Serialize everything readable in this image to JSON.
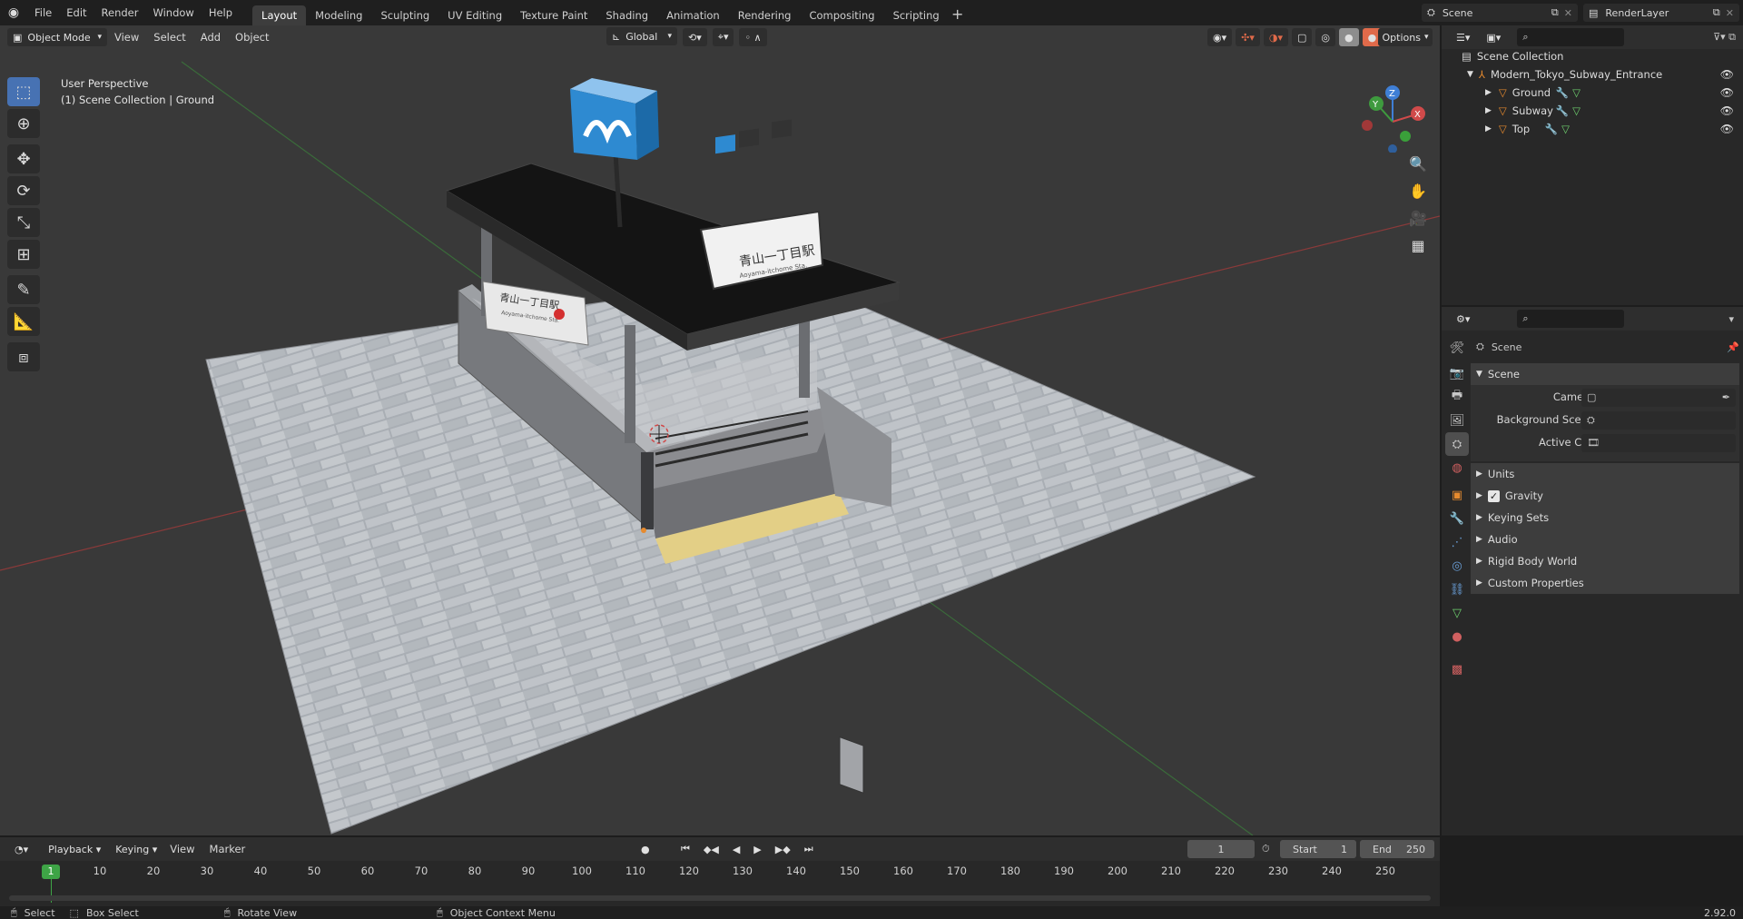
{
  "topbar": {
    "menus": [
      "File",
      "Edit",
      "Render",
      "Window",
      "Help"
    ],
    "workspaces": [
      "Layout",
      "Modeling",
      "Sculpting",
      "UV Editing",
      "Texture Paint",
      "Shading",
      "Animation",
      "Rendering",
      "Compositing",
      "Scripting"
    ],
    "active_workspace": "Layout",
    "add_tab": "+",
    "scene_label": "Scene",
    "renderlayer_label": "RenderLayer"
  },
  "viewport": {
    "mode": "Object Mode",
    "menus": [
      "View",
      "Select",
      "Add",
      "Object"
    ],
    "transform_orientation": "Global",
    "options_label": "Options",
    "overlay_line1": "User Perspective",
    "overlay_line2": "(1) Scene Collection | Ground",
    "gizmo_axes": {
      "x": "X",
      "y": "Y",
      "z": "Z"
    },
    "sign": {
      "main_text": "青山一丁目駅",
      "sub_text": "Aoyama-itchome Sta."
    },
    "side_sign": {
      "main_text": "青山一丁目駅",
      "sub_text": "Aoyama-itchome Sta."
    }
  },
  "outliner": {
    "root": "Scene Collection",
    "collection": "Modern_Tokyo_Subway_Entrance",
    "objects": [
      "Ground",
      "Subway",
      "Top"
    ]
  },
  "properties": {
    "header": "Scene",
    "panel": "Scene",
    "fields": [
      {
        "label": "Camera"
      },
      {
        "label": "Background Scene"
      },
      {
        "label": "Active Clip"
      }
    ],
    "subpanels": [
      "Units",
      "Gravity",
      "Keying Sets",
      "Audio",
      "Rigid Body World",
      "Custom Properties"
    ],
    "gravity_checked": true
  },
  "timeline": {
    "menus": [
      "Playback",
      "Keying",
      "View",
      "Marker"
    ],
    "current_frame": "1",
    "start_label": "Start",
    "start": "1",
    "end_label": "End",
    "end": "250",
    "ruler": [
      "10",
      "20",
      "30",
      "40",
      "50",
      "60",
      "70",
      "80",
      "90",
      "100",
      "110",
      "120",
      "130",
      "140",
      "150",
      "160",
      "170",
      "180",
      "190",
      "200",
      "210",
      "220",
      "230",
      "240",
      "250"
    ],
    "playhead": "1"
  },
  "status": {
    "select": "Select",
    "box_select": "Box Select",
    "rotate_view": "Rotate View",
    "context_menu": "Object Context Menu",
    "version": "2.92.0"
  },
  "colors": {
    "accent": "#4772b3",
    "timeline_playhead": "#3ea446",
    "object_orange": "#e68a2e",
    "x_axis": "#d04a4a",
    "y_axis": "#3e9a3e",
    "z_axis": "#3f7fd6"
  }
}
